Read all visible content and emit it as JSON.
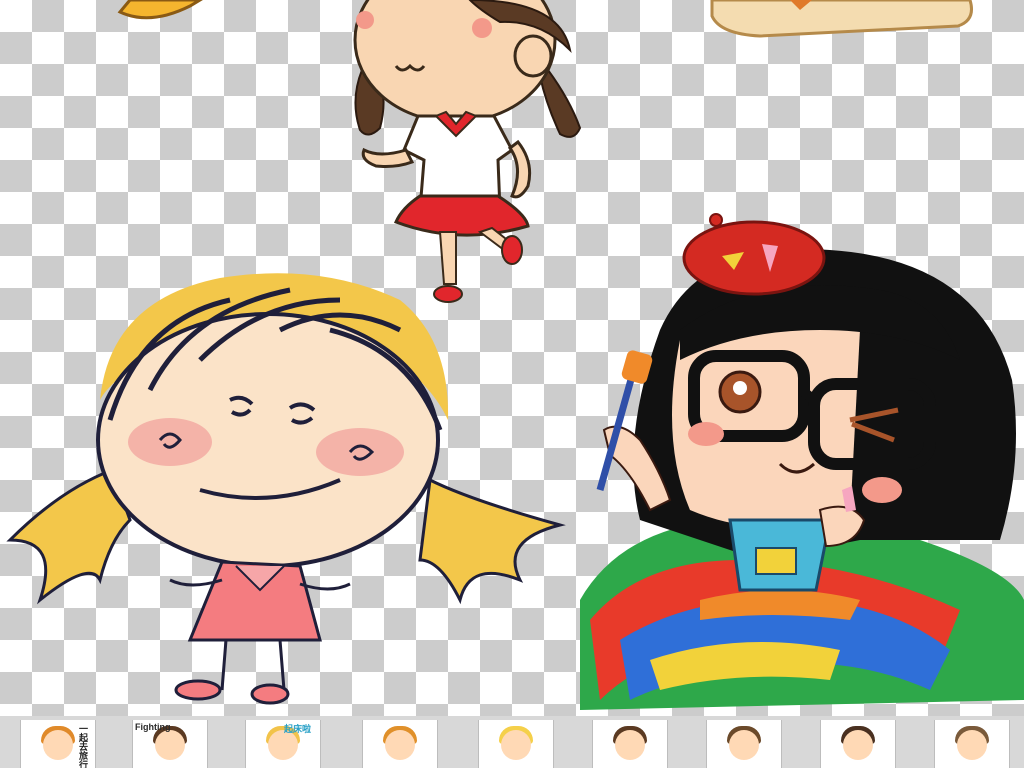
{
  "image": {
    "subject": "cartoon-girls-collage",
    "background": "transparency-checkerboard",
    "colors": {
      "checker_light": "#ffffff",
      "checker_dark": "#cccccc",
      "skirt_red": "#e1262c",
      "hair_blonde": "#f3c74a",
      "glasses_black": "#111111",
      "beret_red": "#d42a22",
      "skin": "#f7d3b0"
    }
  },
  "thumbnails": [
    {
      "caption": "一起去旅行",
      "hair": "#e08a2a",
      "cap_color": "#222222"
    },
    {
      "caption": "Fighting",
      "hair": "#5b3a22",
      "cap_color": "#2a2a2a"
    },
    {
      "caption": "起床啦",
      "hair": "#f2c34a",
      "cap_color": "#2aa1c7"
    },
    {
      "caption": "",
      "hair": "#e0902a",
      "cap_color": "#222222"
    },
    {
      "caption": "",
      "hair": "#f5d04a",
      "cap_color": "#e0437a"
    },
    {
      "caption": "",
      "hair": "#5b3a22",
      "cap_color": "#222222"
    },
    {
      "caption": "",
      "hair": "#6b4a2a",
      "cap_color": "#222222"
    },
    {
      "caption": "",
      "hair": "#4a3020",
      "cap_color": "#e0437a"
    },
    {
      "caption": "",
      "hair": "#7a5a3a",
      "cap_color": "#222222"
    }
  ]
}
